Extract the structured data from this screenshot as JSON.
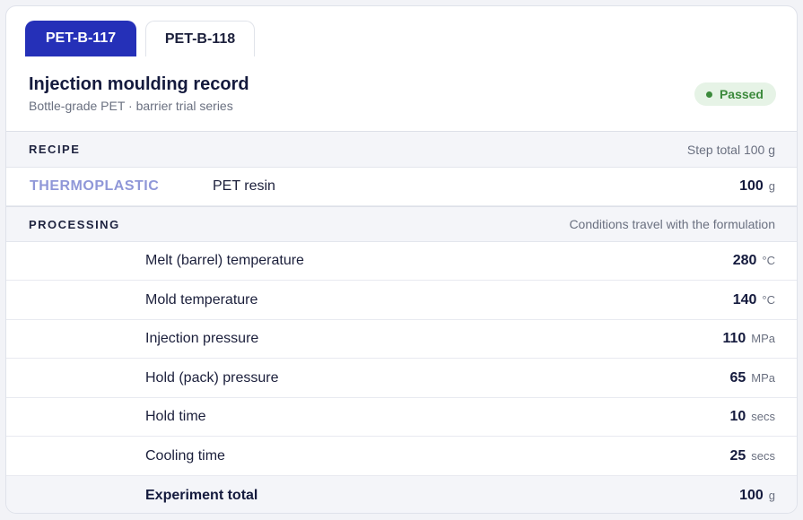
{
  "tabs": [
    {
      "label": "PET-B-117",
      "active": true
    },
    {
      "label": "PET-B-118",
      "active": false
    }
  ],
  "header": {
    "title": "Injection moulding record",
    "subtitle": "Bottle-grade PET · barrier trial series",
    "status": "Passed",
    "status_color": "#3c8a3c"
  },
  "recipe": {
    "heading": "RECIPE",
    "note": "Step total 100 g",
    "category": "THERMOPLASTIC",
    "material": "PET resin",
    "amount": "100",
    "unit": "g"
  },
  "processing": {
    "heading": "PROCESSING",
    "note": "Conditions travel with the formulation",
    "rows": [
      {
        "name": "Melt (barrel) temperature",
        "value": "280",
        "unit": "°C"
      },
      {
        "name": "Mold temperature",
        "value": "140",
        "unit": "°C"
      },
      {
        "name": "Injection pressure",
        "value": "110",
        "unit": "MPa"
      },
      {
        "name": "Hold (pack) pressure",
        "value": "65",
        "unit": "MPa"
      },
      {
        "name": "Hold time",
        "value": "10",
        "unit": "secs"
      },
      {
        "name": "Cooling time",
        "value": "25",
        "unit": "secs"
      }
    ]
  },
  "total": {
    "label": "Experiment total",
    "value": "100",
    "unit": "g"
  },
  "colors": {
    "accent": "#2530b8",
    "category": "#8f97d8"
  }
}
